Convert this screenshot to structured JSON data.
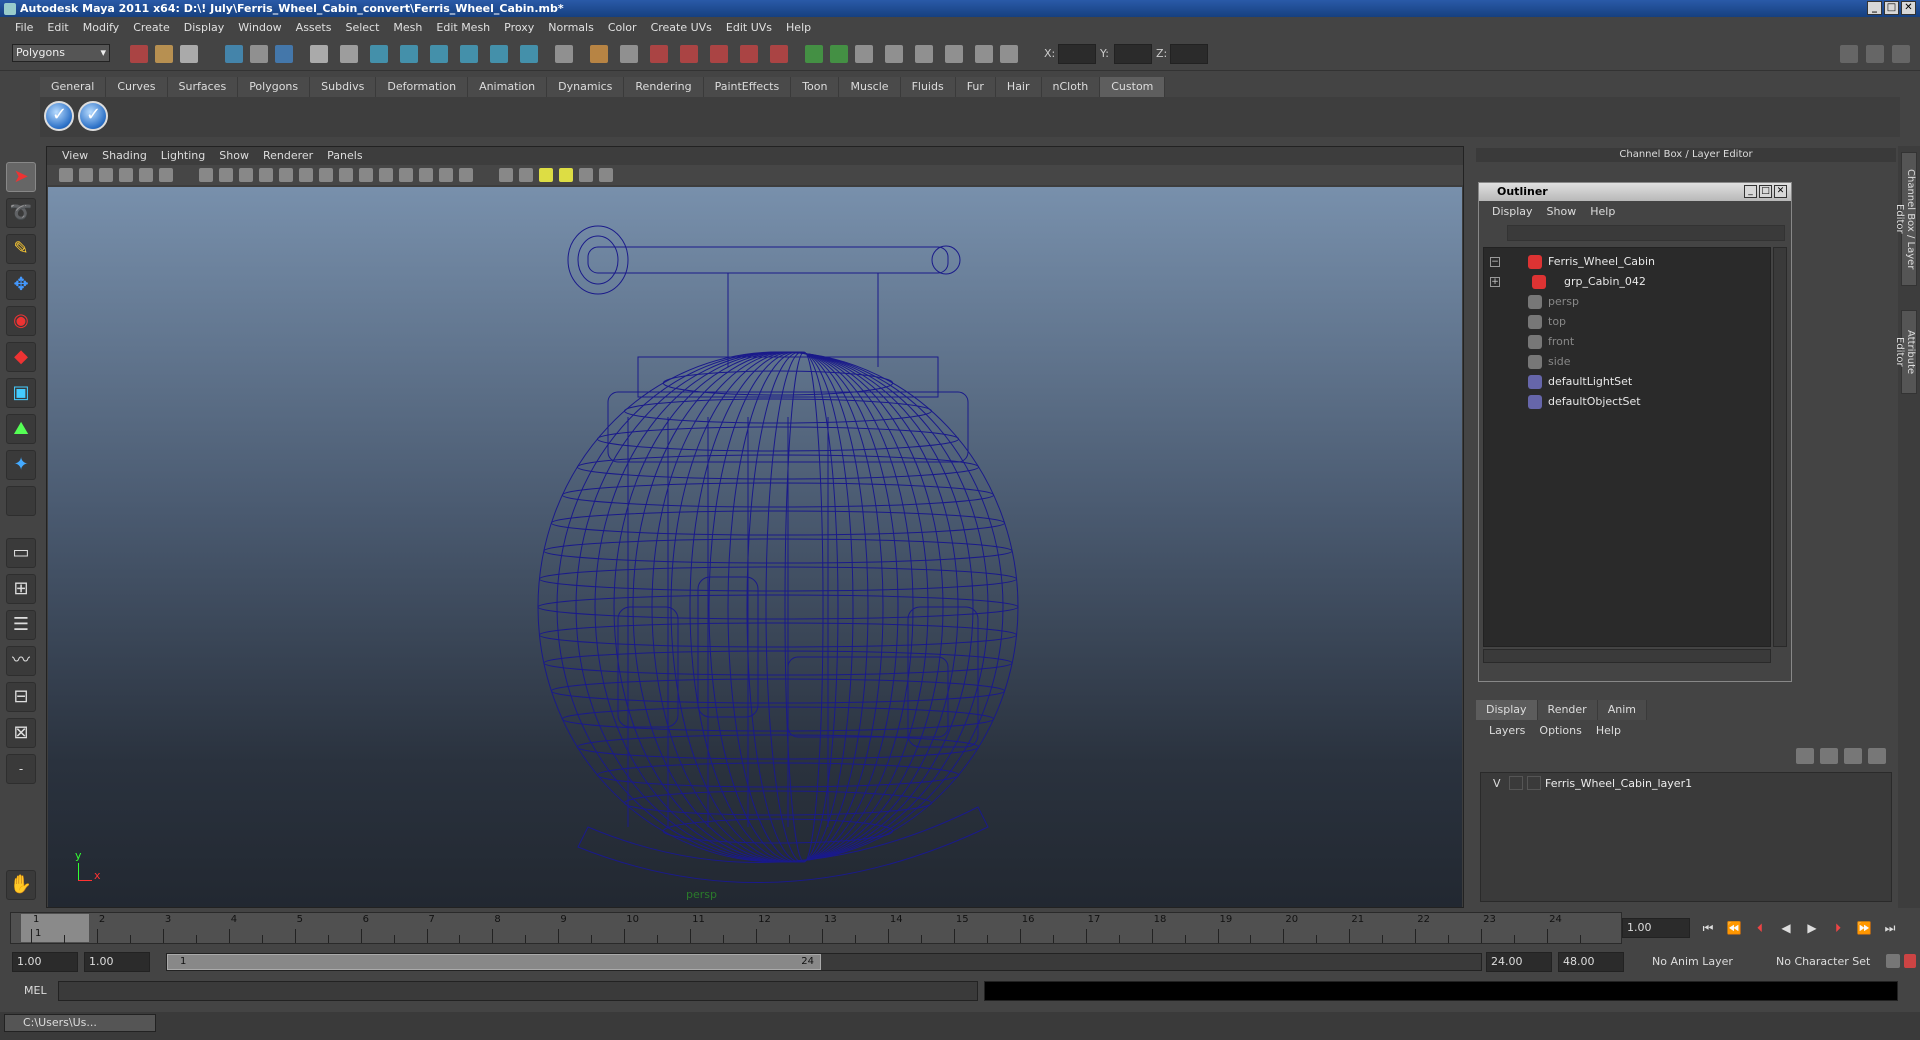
{
  "window": {
    "title": "Autodesk Maya 2011 x64: D:\\! July\\Ferris_Wheel_Cabin_convert\\Ferris_Wheel_Cabin.mb*"
  },
  "menubar": [
    "File",
    "Edit",
    "Modify",
    "Create",
    "Display",
    "Window",
    "Assets",
    "Select",
    "Mesh",
    "Edit Mesh",
    "Proxy",
    "Normals",
    "Color",
    "Create UVs",
    "Edit UVs",
    "Help"
  ],
  "statusline": {
    "mode": "Polygons",
    "x_label": "X:",
    "y_label": "Y:",
    "z_label": "Z:"
  },
  "shelf": {
    "tabs": [
      "General",
      "Curves",
      "Surfaces",
      "Polygons",
      "Subdivs",
      "Deformation",
      "Animation",
      "Dynamics",
      "Rendering",
      "PaintEffects",
      "Toon",
      "Muscle",
      "Fluids",
      "Fur",
      "Hair",
      "nCloth",
      "Custom"
    ],
    "active_tab": "Custom"
  },
  "viewport": {
    "menu": [
      "View",
      "Shading",
      "Lighting",
      "Show",
      "Renderer",
      "Panels"
    ],
    "camera_label": "persp",
    "axis_y": "y",
    "axis_x": "x",
    "wire_color": "#1a1a8a"
  },
  "channel_box": {
    "header": "Channel Box / Layer Editor"
  },
  "outliner": {
    "title": "Outliner",
    "menu": [
      "Display",
      "Show",
      "Help"
    ],
    "items": [
      {
        "label": "Ferris_Wheel_Cabin",
        "dim": false
      },
      {
        "label": "grp_Cabin_042",
        "dim": false
      },
      {
        "label": "persp",
        "dim": true
      },
      {
        "label": "top",
        "dim": true
      },
      {
        "label": "front",
        "dim": true
      },
      {
        "label": "side",
        "dim": true
      },
      {
        "label": "defaultLightSet",
        "dim": false
      },
      {
        "label": "defaultObjectSet",
        "dim": false
      }
    ]
  },
  "layer_editor": {
    "tabs": [
      "Display",
      "Render",
      "Anim"
    ],
    "active_tab": "Display",
    "menu": [
      "Layers",
      "Options",
      "Help"
    ],
    "layer_visibility": "V",
    "layer_name": "Ferris_Wheel_Cabin_layer1"
  },
  "side_tabs": [
    "Channel Box / Layer Editor",
    "Attribute Editor"
  ],
  "timeline": {
    "ticks": [
      "1",
      "2",
      "3",
      "4",
      "5",
      "6",
      "7",
      "8",
      "9",
      "10",
      "11",
      "12",
      "13",
      "14",
      "15",
      "16",
      "17",
      "18",
      "19",
      "20",
      "21",
      "22",
      "23",
      "24"
    ],
    "current_marker": "1",
    "current_frame": "1.00"
  },
  "range": {
    "start": "1.00",
    "playback_start": "1.00",
    "handle_start": "1",
    "handle_end": "24",
    "playback_end": "24.00",
    "end": "48.00",
    "anim_layer": "No Anim Layer",
    "character_set": "No Character Set"
  },
  "command_line": {
    "label": "MEL"
  },
  "taskbar": {
    "item": "C:\\Users\\Us..."
  }
}
